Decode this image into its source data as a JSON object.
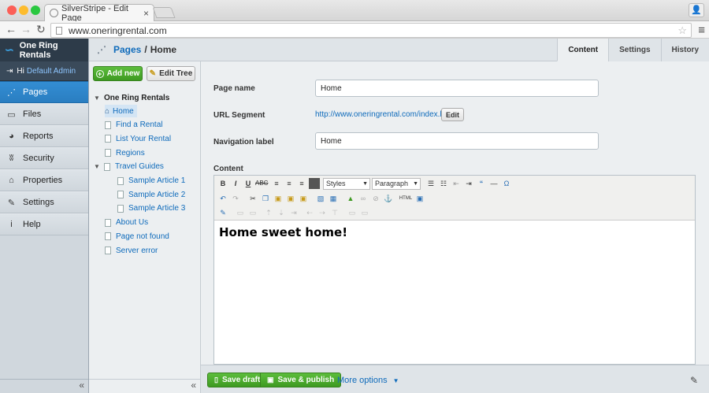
{
  "browser": {
    "tab_title": "SilverStripe - Edit Page",
    "url": "www.oneringrental.com"
  },
  "cms": {
    "brand": "One Ring Rentals",
    "greeting": "Hi",
    "username": "Default Admin",
    "menu": [
      {
        "label": "Pages",
        "icon": "sitemap-icon",
        "glyph": "⋰",
        "active": true
      },
      {
        "label": "Files",
        "icon": "image-icon",
        "glyph": "▭",
        "active": false
      },
      {
        "label": "Reports",
        "icon": "pie-chart-icon",
        "glyph": "◕",
        "active": false
      },
      {
        "label": "Security",
        "icon": "users-icon",
        "glyph": "ʬ",
        "active": false
      },
      {
        "label": "Properties",
        "icon": "house-icon",
        "glyph": "⌂",
        "active": false
      },
      {
        "label": "Settings",
        "icon": "wrench-icon",
        "glyph": "✎",
        "active": false
      },
      {
        "label": "Help",
        "icon": "info-icon",
        "glyph": "i",
        "active": false
      }
    ],
    "collapse": "«"
  },
  "breadcrumb": {
    "parent": "Pages",
    "separator": "/",
    "current": "Home"
  },
  "tree_buttons": {
    "add": "Add new",
    "edit": "Edit Tree"
  },
  "tree": {
    "root": "One Ring Rentals",
    "nodes": [
      {
        "label": "Home",
        "level": 1
      },
      {
        "label": "Find a Rental",
        "level": 1
      },
      {
        "label": "List Your Rental",
        "level": 1
      },
      {
        "label": "Regions",
        "level": 1
      },
      {
        "label": "Travel Guides",
        "level": 1
      },
      {
        "label": "Sample Article 1",
        "level": 2
      },
      {
        "label": "Sample Article 2",
        "level": 2
      },
      {
        "label": "Sample Article 3",
        "level": 2
      },
      {
        "label": "About Us",
        "level": 1
      },
      {
        "label": "Page not found",
        "level": 1
      },
      {
        "label": "Server error",
        "level": 1
      }
    ]
  },
  "tabs": [
    "Content",
    "Settings",
    "History"
  ],
  "form": {
    "page_name_label": "Page name",
    "page_name_value": "Home",
    "url_segment_label": "URL Segment",
    "url_segment_value": "http://www.oneringrental.com/index.html",
    "url_edit": "Edit",
    "nav_label_label": "Navigation label",
    "nav_label_value": "Home",
    "content_label": "Content",
    "styles_select": "Styles",
    "format_select": "Paragraph",
    "body_text": "Home sweet home!"
  },
  "actions": {
    "save_draft": "Save draft",
    "save_publish": "Save & publish",
    "more_options": "More options"
  }
}
